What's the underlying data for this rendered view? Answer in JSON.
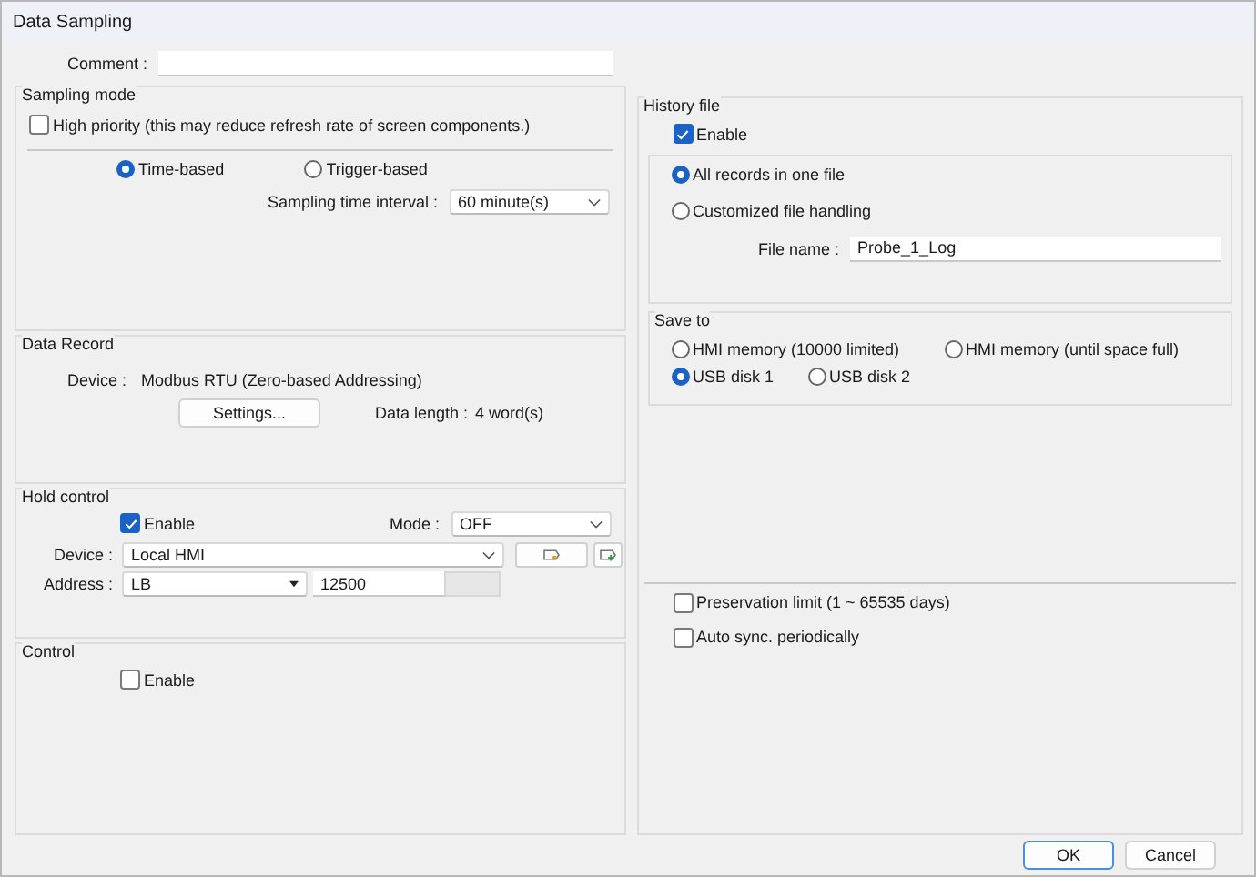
{
  "window": {
    "title": "Data Sampling"
  },
  "comment": {
    "label": "Comment :"
  },
  "sampling_mode": {
    "title": "Sampling mode",
    "high_priority": {
      "label": "High priority (this may reduce refresh rate of screen components.)",
      "checked": false
    },
    "modes": [
      {
        "label": "Time-based",
        "selected": true
      },
      {
        "label": "Trigger-based",
        "selected": false
      }
    ],
    "interval": {
      "label": "Sampling time interval  :",
      "value": "60 minute(s)"
    }
  },
  "data_record": {
    "title": "Data Record",
    "device_label": "Device :",
    "device_value": "Modbus RTU (Zero-based Addressing)",
    "settings_button": "Settings...",
    "data_length_label": "Data length :",
    "data_length_value": "4 word(s)"
  },
  "hold_control": {
    "title": "Hold control",
    "enable": {
      "label": "Enable",
      "checked": true
    },
    "mode": {
      "label": "Mode :",
      "value": "OFF"
    },
    "device": {
      "label": "Device :",
      "value": "Local HMI"
    },
    "address": {
      "label": "Address :",
      "type": "LB",
      "value": "12500"
    }
  },
  "control": {
    "title": "Control",
    "enable": {
      "label": "Enable",
      "checked": false
    }
  },
  "history_file": {
    "title": "History file",
    "enable": {
      "label": "Enable",
      "checked": true
    },
    "handling": [
      {
        "label": "All records in one file",
        "selected": true
      },
      {
        "label": "Customized file handling",
        "selected": false
      }
    ],
    "file_name": {
      "label": "File name :",
      "value": "Probe_1_Log"
    },
    "save_to": {
      "title": "Save to",
      "options": [
        {
          "label": "HMI memory (10000 limited)",
          "selected": false
        },
        {
          "label": "HMI memory (until space full)",
          "selected": false
        },
        {
          "label": "USB disk 1",
          "selected": true
        },
        {
          "label": "USB disk 2",
          "selected": false
        }
      ]
    },
    "options": [
      {
        "label": "Preservation limit (1 ~ 65535 days)",
        "checked": false
      },
      {
        "label": "Auto sync. periodically",
        "checked": false
      }
    ]
  },
  "buttons": [
    {
      "label": "OK",
      "default": true
    },
    {
      "label": "Cancel",
      "default": false
    }
  ]
}
